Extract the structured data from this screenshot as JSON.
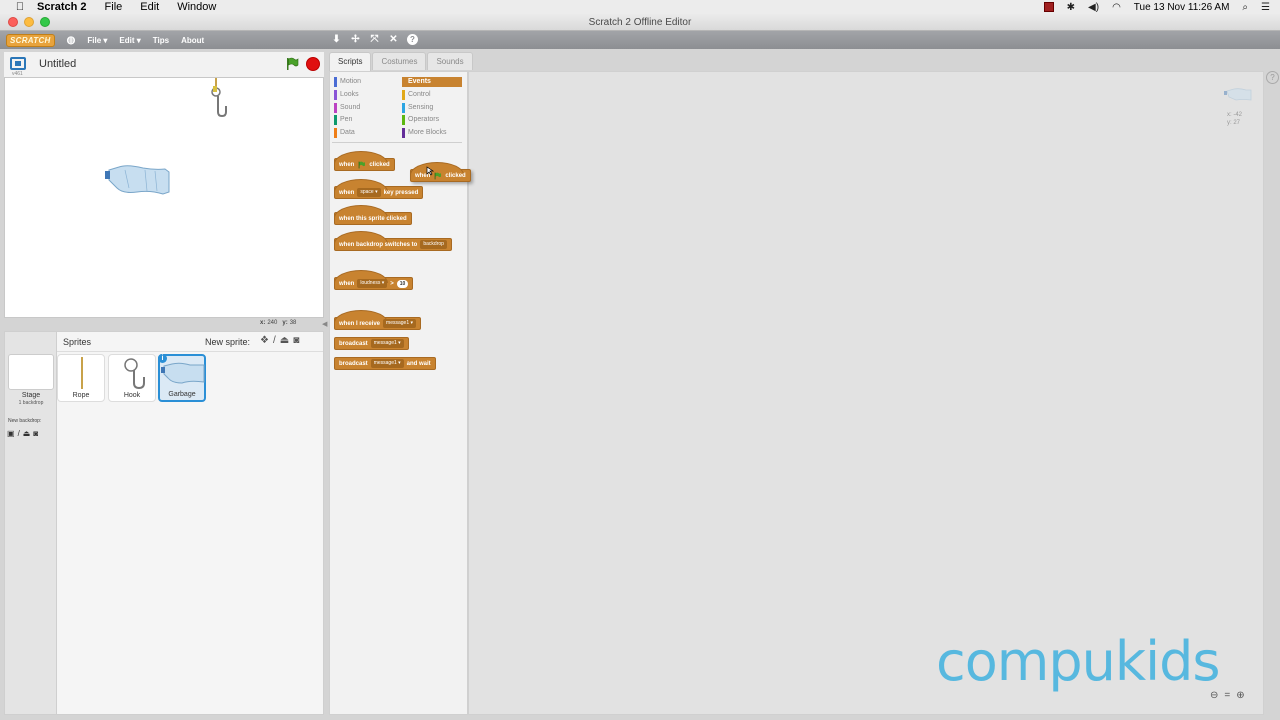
{
  "mac_menubar": {
    "app_name": "Scratch 2",
    "menus": [
      "File",
      "Edit",
      "Window"
    ],
    "datetime": "Tue 13 Nov  11:26 AM"
  },
  "window": {
    "title": "Scratch 2 Offline Editor"
  },
  "scratch_menubar": {
    "logo": "SCRATCH",
    "file": "File ▾",
    "edit": "Edit ▾",
    "tips": "Tips",
    "about": "About"
  },
  "stage": {
    "version": "v461",
    "project_title": "Untitled",
    "x_label": "x:",
    "x_value": "240",
    "y_label": "y:",
    "y_value": "38"
  },
  "sprites_panel": {
    "title": "Sprites",
    "new_sprite_label": "New sprite:",
    "stage_label": "Stage",
    "stage_backdrops": "1 backdrop",
    "new_backdrop_label": "New backdrop:",
    "sprites": [
      {
        "name": "Rope"
      },
      {
        "name": "Hook"
      },
      {
        "name": "Garbage"
      }
    ]
  },
  "tabs": [
    "Scripts",
    "Costumes",
    "Sounds"
  ],
  "categories": [
    {
      "label": "Motion",
      "color": "#4a6cd4"
    },
    {
      "label": "Looks",
      "color": "#8a55d7"
    },
    {
      "label": "Sound",
      "color": "#bb42c3"
    },
    {
      "label": "Pen",
      "color": "#0e9a6c"
    },
    {
      "label": "Data",
      "color": "#ee7d16"
    },
    {
      "label": "Events",
      "color": "#c88330"
    },
    {
      "label": "Control",
      "color": "#e1a91a"
    },
    {
      "label": "Sensing",
      "color": "#2ca5e2"
    },
    {
      "label": "Operators",
      "color": "#5cb712"
    },
    {
      "label": "More Blocks",
      "color": "#632d99"
    }
  ],
  "blocks": {
    "when": "when",
    "clicked": "clicked",
    "key_pressed": "key pressed",
    "space": "space",
    "sprite_clicked": "when this sprite clicked",
    "backdrop_switches": "when backdrop switches to",
    "backdrop": "backdrop",
    "loudness": "loudness",
    "greater": ">",
    "loudness_value": "10",
    "when_i_receive": "when I receive",
    "message1": "message1",
    "broadcast": "broadcast",
    "and_wait": "and wait"
  },
  "script_area": {
    "x_readout": "x: -42",
    "y_readout": "y: 27"
  },
  "watermark": "compukids"
}
